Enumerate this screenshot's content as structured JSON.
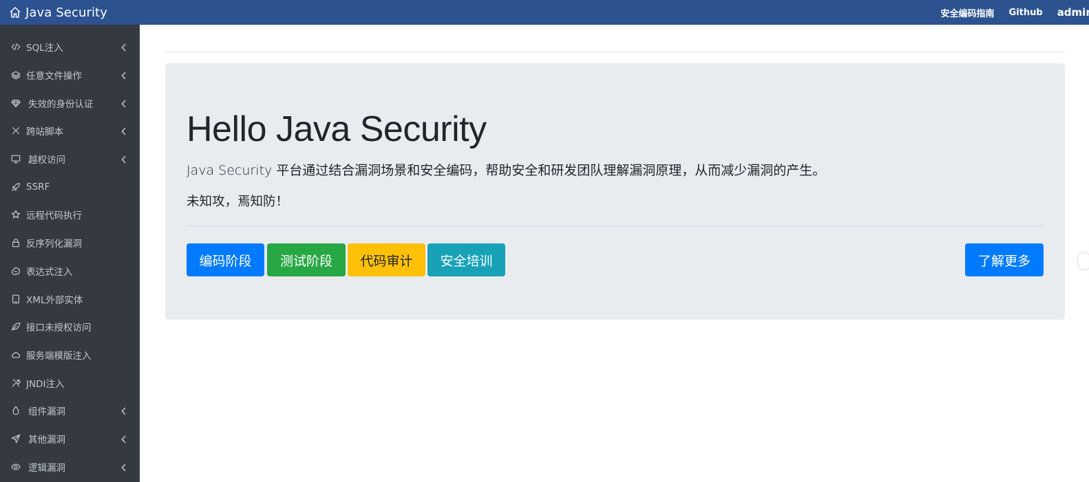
{
  "navbar": {
    "brand": "Java Security",
    "links": [
      {
        "label": "安全编码指南",
        "icon": ""
      },
      {
        "label": "Github",
        "icon": ""
      },
      {
        "label": "admin",
        "icon": ""
      }
    ]
  },
  "sidebar": {
    "items": [
      {
        "label": "SQL注入",
        "icon": "code-icon",
        "has_submenu": true
      },
      {
        "label": "任意文件操作",
        "icon": "layers-icon",
        "has_submenu": true
      },
      {
        "label": "失效的身份认证",
        "icon": "diamond-icon",
        "has_submenu": true
      },
      {
        "label": "跨站脚本",
        "icon": "x-icon",
        "has_submenu": true
      },
      {
        "label": "越权访问",
        "icon": "monitor-icon",
        "has_submenu": true
      },
      {
        "label": "SSRF",
        "icon": "rocket-icon",
        "has_submenu": false
      },
      {
        "label": "远程代码执行",
        "icon": "star-icon",
        "has_submenu": false
      },
      {
        "label": "反序列化漏洞",
        "icon": "lock-icon",
        "has_submenu": false
      },
      {
        "label": "表达式注入",
        "icon": "puzzle-icon",
        "has_submenu": false
      },
      {
        "label": "XML外部实体",
        "icon": "tablet-icon",
        "has_submenu": false
      },
      {
        "label": "接口未授权访问",
        "icon": "leaf-icon",
        "has_submenu": false
      },
      {
        "label": "服务端模版注入",
        "icon": "cloud-icon",
        "has_submenu": false
      },
      {
        "label": "JNDI注入",
        "icon": "tools-icon",
        "has_submenu": false
      },
      {
        "label": "组件漏洞",
        "icon": "droplet-icon",
        "has_submenu": true
      },
      {
        "label": "其他漏洞",
        "icon": "send-icon",
        "has_submenu": true
      },
      {
        "label": "逻辑漏洞",
        "icon": "eye-icon",
        "has_submenu": true
      }
    ]
  },
  "jumbotron": {
    "title": "Hello Java Security",
    "lead": "Java Security 平台通过结合漏洞场景和安全编码，帮助安全和研发团队理解漏洞原理，从而减少漏洞的产生。",
    "motto": "未知攻，焉知防！",
    "buttons": {
      "coding": "编码阶段",
      "testing": "测试阶段",
      "audit": "代码审计",
      "training": "安全培训",
      "learn_more": "了解更多"
    }
  },
  "colors": {
    "navbar": "#2c5290",
    "sidebar": "#343a40",
    "primary": "#007bff",
    "success": "#28a745",
    "warning": "#ffc107",
    "info": "#17a2b8"
  }
}
